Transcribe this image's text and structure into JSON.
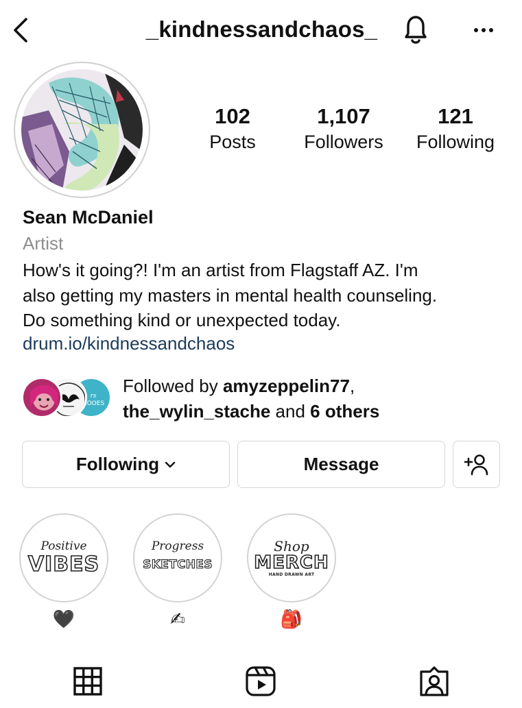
{
  "header": {
    "username": "_kindnessandchaos_",
    "icons": {
      "back": "chevron-left-icon",
      "notifications": "bell-icon",
      "more": "more-horizontal-icon"
    }
  },
  "profile": {
    "stats": [
      {
        "value": "102",
        "label": "Posts"
      },
      {
        "value": "1,107",
        "label": "Followers"
      },
      {
        "value": "121",
        "label": "Following"
      }
    ],
    "name": "Sean McDaniel",
    "category": "Artist",
    "bio_lines": [
      "How's it going?! I'm an artist from Flagstaff AZ. I'm",
      "also getting my masters in mental health counseling.",
      "Do something kind or unexpected today."
    ],
    "link": "drum.io/kindnessandchaos"
  },
  "followed_by": {
    "prefix": "Followed by ",
    "user1": "amyzeppelin77",
    "comma": ",",
    "user2": "the_wylin_stache",
    "middle": " and ",
    "others": "6 others",
    "avatar_texts": {
      "third": "rs HOOES"
    }
  },
  "actions": {
    "following_label": "Following",
    "message_label": "Message",
    "add_user_icon": "person-add-icon"
  },
  "highlights": [
    {
      "script": "Positive",
      "big": "VIBES",
      "emoji": "🖤"
    },
    {
      "script": "Progress",
      "big": "SKETCHES",
      "emoji": "✍"
    },
    {
      "script": "Shop",
      "big": "MERCH",
      "small": "HAND DRAWN ART",
      "emoji": "🎒"
    }
  ],
  "tabs": [
    {
      "icon": "grid-icon"
    },
    {
      "icon": "reels-icon"
    },
    {
      "icon": "tagged-icon"
    }
  ],
  "colors": {
    "link": "#1b3a5a",
    "muted": "#8e8e8e",
    "border": "#d6d6d6"
  }
}
